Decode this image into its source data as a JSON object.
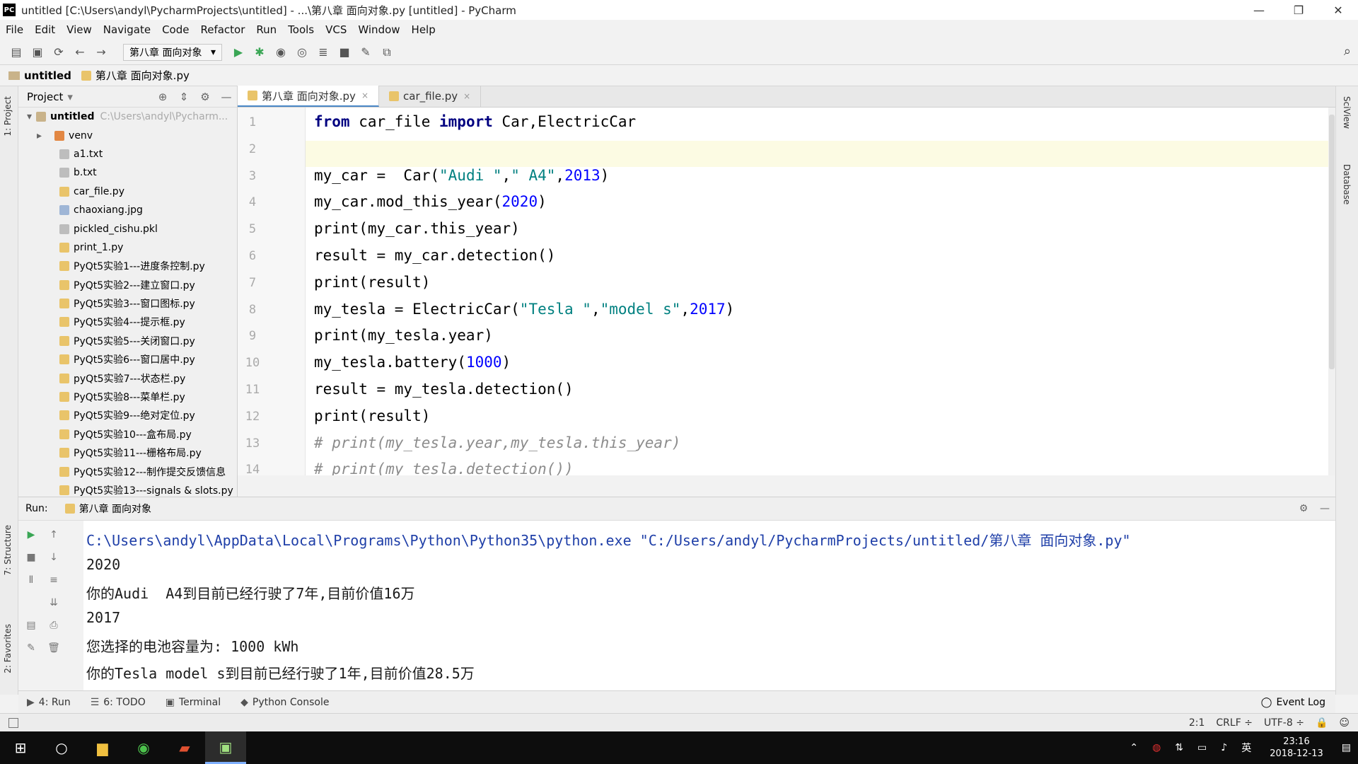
{
  "window": {
    "title": "untitled [C:\\Users\\andyl\\PycharmProjects\\untitled] - ...\\第八章 面向对象.py [untitled] - PyCharm",
    "app_icon": "PC"
  },
  "menu": [
    "File",
    "Edit",
    "View",
    "Navigate",
    "Code",
    "Refactor",
    "Run",
    "Tools",
    "VCS",
    "Window",
    "Help"
  ],
  "toolbar": {
    "run_config": "第八章 面向对象"
  },
  "breadcrumb": [
    "untitled",
    "第八章 面向对象.py"
  ],
  "project_panel": {
    "title": "Project",
    "root": "untitled",
    "root_path": "C:\\Users\\andyl\\Pycharm...",
    "items": [
      {
        "name": "venv",
        "type": "folder-orange"
      },
      {
        "name": "a1.txt",
        "type": "txt"
      },
      {
        "name": "b.txt",
        "type": "txt"
      },
      {
        "name": "car_file.py",
        "type": "py"
      },
      {
        "name": "chaoxiang.jpg",
        "type": "img"
      },
      {
        "name": "pickled_cishu.pkl",
        "type": "txt"
      },
      {
        "name": "print_1.py",
        "type": "py"
      },
      {
        "name": "PyQt5实验1---进度条控制.py",
        "type": "py"
      },
      {
        "name": "PyQt5实验2---建立窗口.py",
        "type": "py"
      },
      {
        "name": "PyQt5实验3---窗口图标.py",
        "type": "py"
      },
      {
        "name": "PyQt5实验4---提示框.py",
        "type": "py"
      },
      {
        "name": "PyQt5实验5---关闭窗口.py",
        "type": "py"
      },
      {
        "name": "PyQt5实验6---窗口居中.py",
        "type": "py"
      },
      {
        "name": "pyQt5实验7---状态栏.py",
        "type": "py"
      },
      {
        "name": "PyQt5实验8---菜单栏.py",
        "type": "py"
      },
      {
        "name": "PyQt5实验9---绝对定位.py",
        "type": "py"
      },
      {
        "name": "PyQt5实验10---盒布局.py",
        "type": "py"
      },
      {
        "name": "PyQt5实验11---栅格布局.py",
        "type": "py"
      },
      {
        "name": "PyQt5实验12---制作提交反馈信息",
        "type": "py"
      },
      {
        "name": "PyQt5实验13---signals & slots.py",
        "type": "py"
      }
    ]
  },
  "editor_tabs": [
    {
      "label": "第八章 面向对象.py",
      "active": true
    },
    {
      "label": "car_file.py",
      "active": false
    }
  ],
  "code_lines": [
    {
      "n": "1",
      "text": "from car_file import Car,ElectricCar"
    },
    {
      "n": "2",
      "text": ""
    },
    {
      "n": "3",
      "text": "my_car =  Car(\"Audi \",\" A4\",2013)"
    },
    {
      "n": "4",
      "text": "my_car.mod_this_year(2020)"
    },
    {
      "n": "5",
      "text": "print(my_car.this_year)"
    },
    {
      "n": "6",
      "text": "result = my_car.detection()"
    },
    {
      "n": "7",
      "text": "print(result)"
    },
    {
      "n": "8",
      "text": "my_tesla = ElectricCar(\"Tesla \",\"model s\",2017)"
    },
    {
      "n": "9",
      "text": "print(my_tesla.year)"
    },
    {
      "n": "10",
      "text": "my_tesla.battery(1000)"
    },
    {
      "n": "11",
      "text": "result = my_tesla.detection()"
    },
    {
      "n": "12",
      "text": "print(result)"
    },
    {
      "n": "13",
      "text": "# print(my_tesla.year,my_tesla.this_year)"
    },
    {
      "n": "14",
      "text": "# print(my_tesla.detection())"
    }
  ],
  "run_panel": {
    "label": "Run:",
    "tab": "第八章 面向对象",
    "output": [
      {
        "text": "C:\\Users\\andyl\\AppData\\Local\\Programs\\Python\\Python35\\python.exe \"C:/Users/andyl/PycharmProjects/untitled/第八章 面向对象.py\"",
        "kind": "cmd"
      },
      {
        "text": "2020",
        "kind": "out"
      },
      {
        "text": "你的Audi  A4到目前已经行驶了7年,目前价值16万",
        "kind": "out"
      },
      {
        "text": "2017",
        "kind": "out"
      },
      {
        "text": "您选择的电池容量为: 1000 kWh",
        "kind": "out"
      },
      {
        "text": "你的Tesla model s到目前已经行驶了1年,目前价值28.5万",
        "kind": "out"
      }
    ]
  },
  "tool_tabs": [
    {
      "label": "4: Run",
      "icon": "▶"
    },
    {
      "label": "6: TODO",
      "icon": "☰"
    },
    {
      "label": "Terminal",
      "icon": "▣"
    },
    {
      "label": "Python Console",
      "icon": "◆"
    }
  ],
  "event_log": "Event Log",
  "side_tabs_left": [
    "1: Project",
    "7: Structure",
    "2: Favorites"
  ],
  "side_tabs_right": [
    "SciView",
    "Database"
  ],
  "status": {
    "position": "2:1",
    "line_sep": "CRLF ÷",
    "encoding": "UTF-8 ÷"
  },
  "taskbar": {
    "time": "23:16",
    "date": "2018-12-13",
    "lang": "英"
  }
}
